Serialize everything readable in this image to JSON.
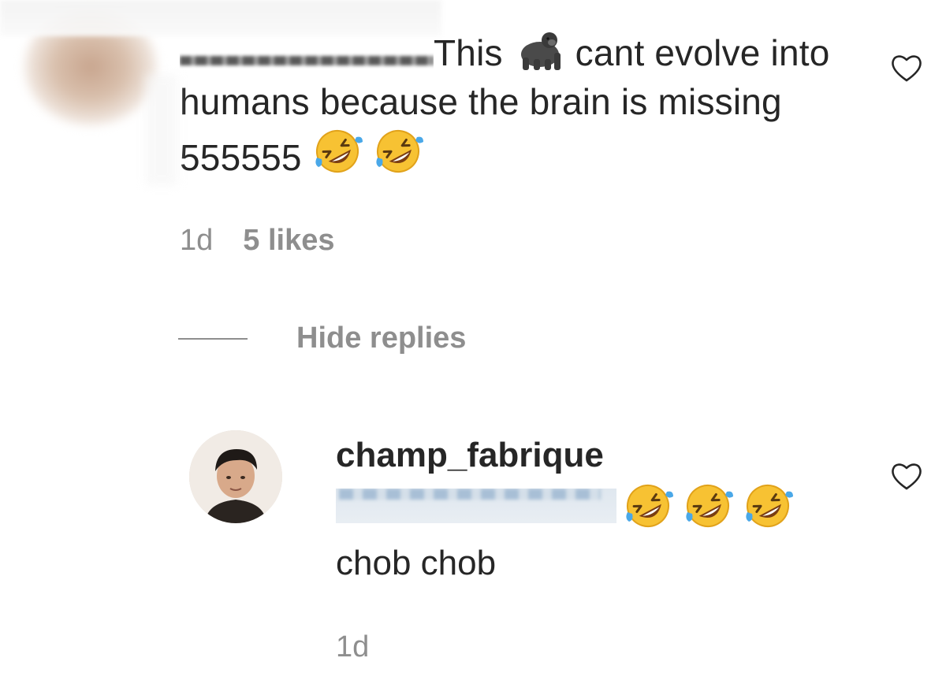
{
  "parent_comment": {
    "text_before": "This",
    "text_after": "cant evolve into humans because the brain is missing 555555",
    "emoji_inline": "gorilla",
    "emoji_trailing": [
      "rolling-on-floor-laughing",
      "rolling-on-floor-laughing"
    ],
    "time": "1d",
    "likes": "5 likes"
  },
  "replies_toggle": {
    "label": "Hide replies"
  },
  "reply": {
    "username": "champ_fabrique",
    "emojis": [
      "rolling-on-floor-laughing",
      "rolling-on-floor-laughing",
      "rolling-on-floor-laughing"
    ],
    "text": "chob chob",
    "time": "1d"
  },
  "icons": {
    "like": "heart-outline-icon"
  },
  "colors": {
    "primary_text": "#262626",
    "secondary_text": "#8e8e8e",
    "background": "#ffffff"
  }
}
